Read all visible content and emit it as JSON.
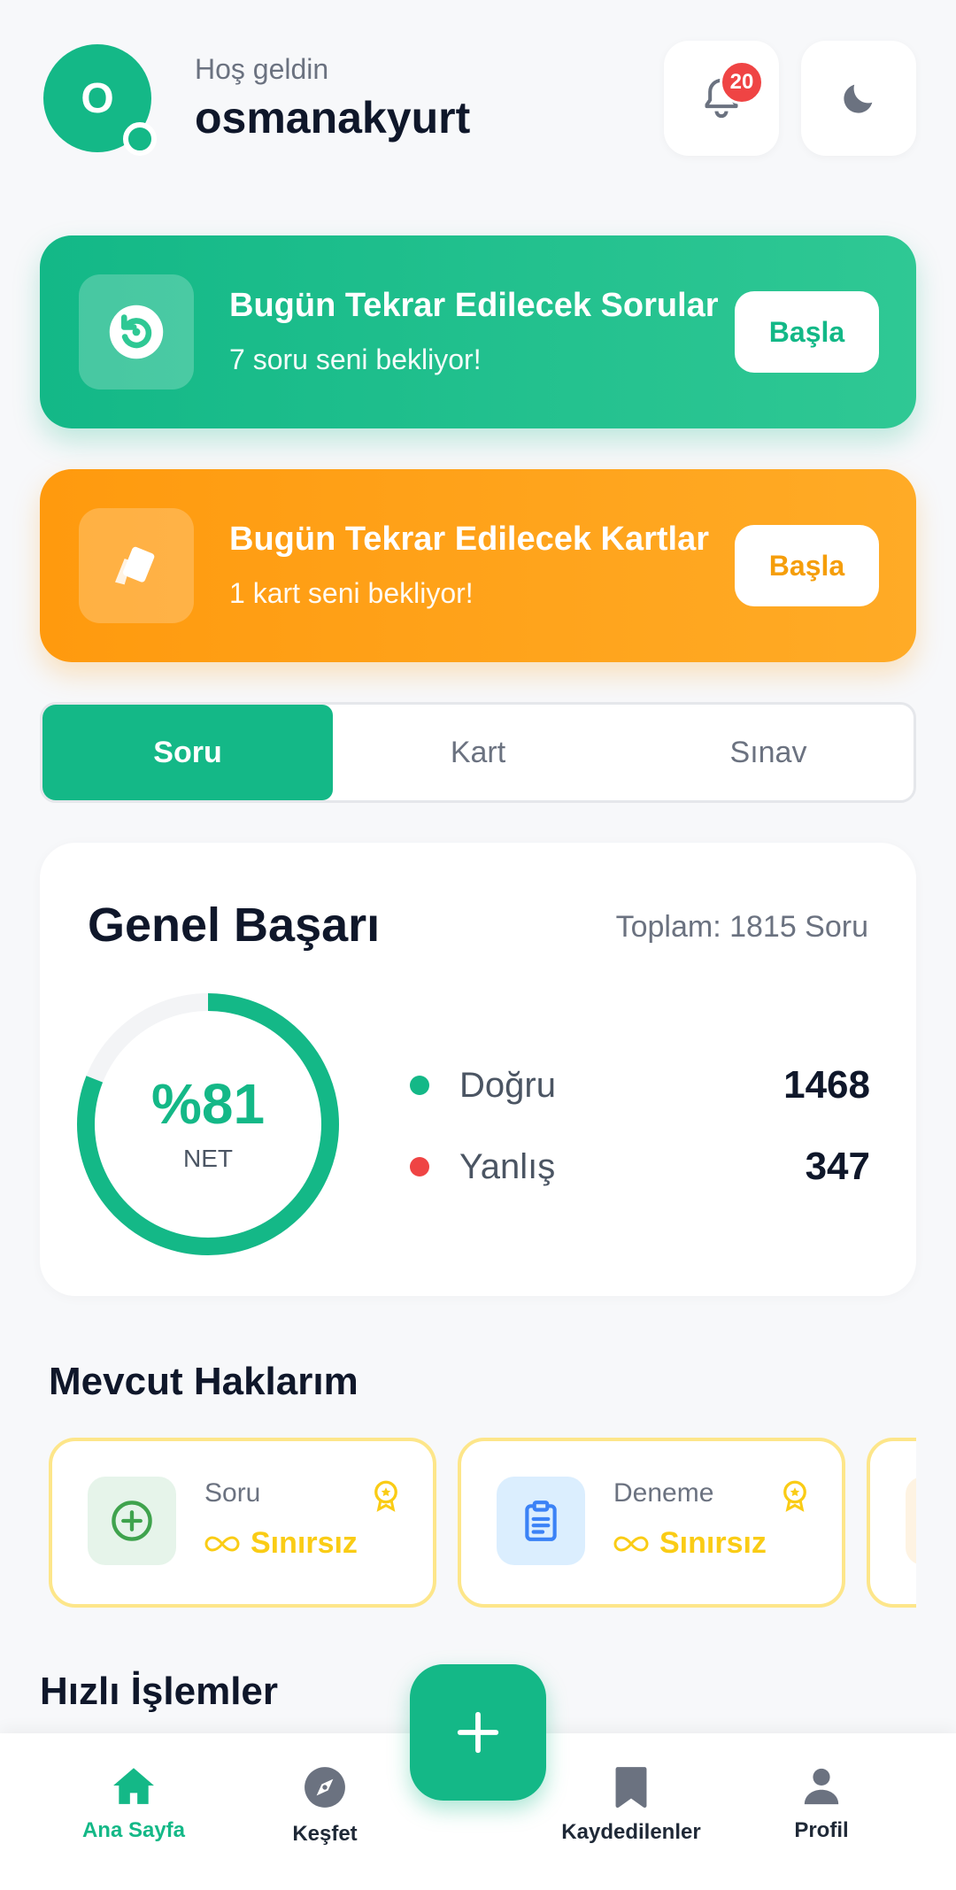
{
  "header": {
    "avatar_initial": "O",
    "greeting": "Hoş geldin",
    "username": "osmanakyurt",
    "notification_count": "20"
  },
  "review_cards": [
    {
      "title": "Bugün Tekrar Edilecek Sorular",
      "subtitle": "7 soru seni bekliyor!",
      "button": "Başla",
      "icon": "refresh-icon",
      "color": "#14B887"
    },
    {
      "title": "Bugün Tekrar Edilecek Kartlar",
      "subtitle": "1 kart seni bekliyor!",
      "button": "Başla",
      "icon": "cards-icon",
      "color": "#FF9A0E"
    }
  ],
  "tabs": [
    {
      "label": "Soru",
      "active": true
    },
    {
      "label": "Kart",
      "active": false
    },
    {
      "label": "Sınav",
      "active": false
    }
  ],
  "success": {
    "title": "Genel Başarı",
    "total": "Toplam: 1815 Soru",
    "percent_label": "%81",
    "percent": 0.81,
    "net_label": "NET",
    "correct_label": "Doğru",
    "correct_value": "1468",
    "wrong_label": "Yanlış",
    "wrong_value": "347",
    "accent": "#14B887",
    "wrong_color": "#EF4444"
  },
  "rights": {
    "title": "Mevcut Haklarım",
    "items": [
      {
        "name": "Soru",
        "value": "Sınırsız",
        "icon": "plus-circle-icon"
      },
      {
        "name": "Deneme",
        "value": "Sınırsız",
        "icon": "clipboard-icon"
      }
    ]
  },
  "quick": {
    "title": "Hızlı İşlemler"
  },
  "nav": [
    {
      "label": "Ana Sayfa",
      "icon": "home-icon",
      "active": true
    },
    {
      "label": "Keşfet",
      "icon": "compass-icon",
      "active": false
    },
    {
      "label": "Kaydedilenler",
      "icon": "bookmark-icon",
      "active": false
    },
    {
      "label": "Profil",
      "icon": "person-icon",
      "active": false
    }
  ]
}
